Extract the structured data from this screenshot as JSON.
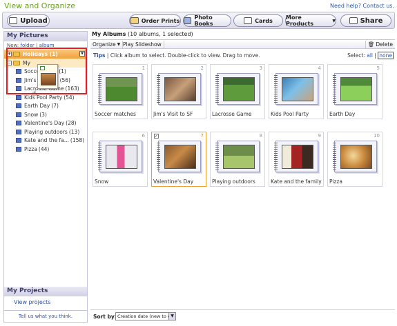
{
  "header": {
    "title": "View and Organize",
    "help_link": "Need help?",
    "contact_link": "Contact us."
  },
  "toolbar": {
    "upload": "Upload",
    "order_prints": "Order Prints",
    "photo_books": "Photo Books",
    "cards": "Cards",
    "more_products": "More Products",
    "share": "Share"
  },
  "sidebar": {
    "title": "My Pictures",
    "new_label": "New:",
    "new_folder": "folder",
    "new_album": "album",
    "holidays": "Holidays (1)",
    "my_albums_prefix": "My",
    "items": [
      {
        "label": "Socce",
        "count": "(1)"
      },
      {
        "label": "Jim's",
        "count": "(56)"
      },
      {
        "label": "Lacrosse Game",
        "count": "(163)"
      },
      {
        "label": "Kids Pool Party",
        "count": "(54)"
      },
      {
        "label": "Earth Day",
        "count": "(7)"
      },
      {
        "label": "Snow",
        "count": "(3)"
      },
      {
        "label": "Valentine's Day",
        "count": "(28)"
      },
      {
        "label": "Playing outdoors",
        "count": "(13)"
      },
      {
        "label": "Kate and the fa...",
        "count": "(158)"
      },
      {
        "label": "Pizza",
        "count": "(44)"
      }
    ],
    "projects_title": "My Projects",
    "view_projects": "View projects",
    "tell_us": "Tell us what you think."
  },
  "main": {
    "title": "My Albums",
    "subtitle": "(10 albums, 1 selected)",
    "organize": "Organize",
    "play_slideshow": "Play Slideshow",
    "delete": "Delete",
    "tips_label": "Tips",
    "tips_text": "| Click album to select. Double-click to view. Drag to move.",
    "select_label": "Select:",
    "select_all": "all",
    "select_none": "none",
    "sort_label": "Sort by:",
    "sort_value": "Creation date (new to old)"
  },
  "albums": [
    {
      "num": "1",
      "caption": "Soccer matches"
    },
    {
      "num": "2",
      "caption": "Jim's Visit to SF"
    },
    {
      "num": "3",
      "caption": "Lacrosse Game"
    },
    {
      "num": "4",
      "caption": "Kids Pool Party"
    },
    {
      "num": "5",
      "caption": "Earth Day"
    },
    {
      "num": "6",
      "caption": "Snow"
    },
    {
      "num": "7",
      "caption": "Valentine's Day"
    },
    {
      "num": "8",
      "caption": "Playing outdoors"
    },
    {
      "num": "9",
      "caption": "Kate and the family"
    },
    {
      "num": "10",
      "caption": "Pizza"
    }
  ],
  "colors": {
    "title_green": "#6aa121",
    "link_blue": "#2c52a0",
    "selection_orange": "#f0a030",
    "drag_highlight_red": "#e02020"
  }
}
